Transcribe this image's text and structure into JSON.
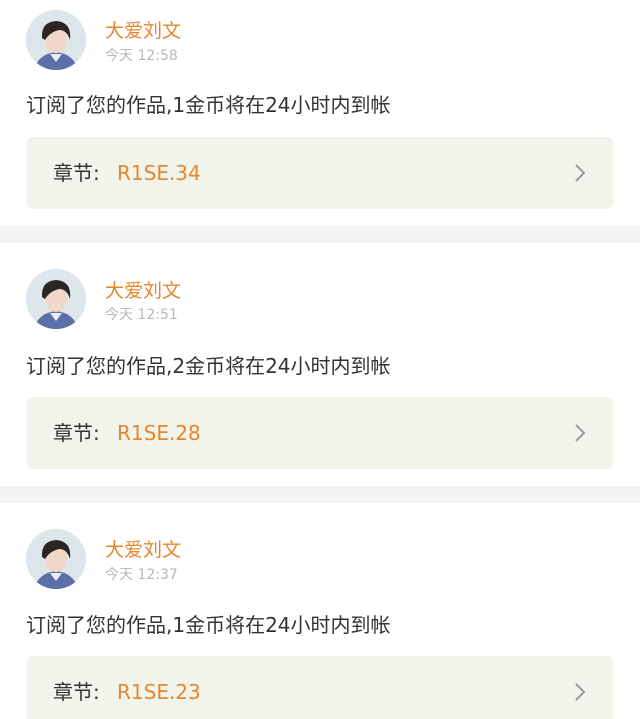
{
  "colors": {
    "accent": "#e8862e",
    "text": "#333333",
    "muted": "#b8b8b8",
    "chapter_bg": "#f1f4ea",
    "page_bg": "#f4f4f4"
  },
  "notifications": [
    {
      "username": "大爱刘文",
      "time": "今天 12:58",
      "message": "订阅了您的作品,1金币将在24小时内到帐",
      "chapter_label": "章节:",
      "chapter_value": "R1SE.34",
      "avatar_icon": "avatar-photo-icon",
      "chevron_icon": "chevron-right-icon"
    },
    {
      "username": "大爱刘文",
      "time": "今天 12:51",
      "message": "订阅了您的作品,2金币将在24小时内到帐",
      "chapter_label": "章节:",
      "chapter_value": "R1SE.28",
      "avatar_icon": "avatar-photo-icon",
      "chevron_icon": "chevron-right-icon"
    },
    {
      "username": "大爱刘文",
      "time": "今天 12:37",
      "message": "订阅了您的作品,1金币将在24小时内到帐",
      "chapter_label": "章节:",
      "chapter_value": "R1SE.23",
      "avatar_icon": "avatar-photo-icon",
      "chevron_icon": "chevron-right-icon"
    }
  ]
}
